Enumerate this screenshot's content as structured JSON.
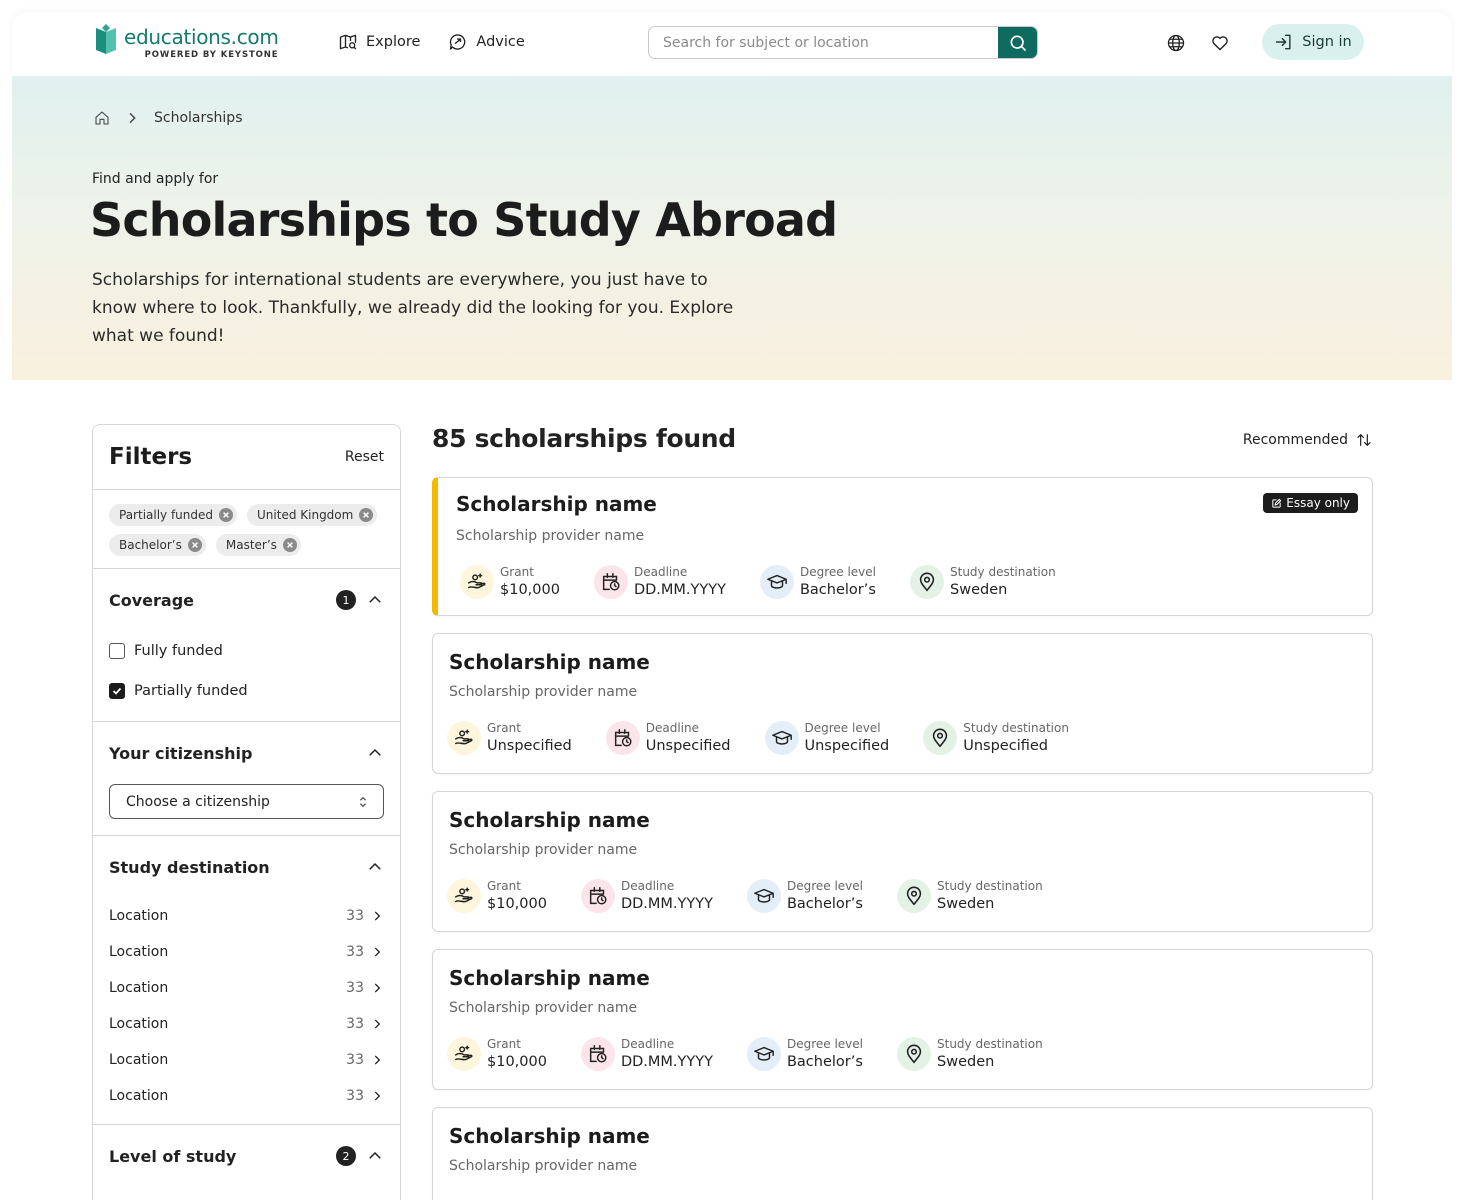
{
  "header": {
    "logo_name": "educations.com",
    "logo_sub": "POWERED BY KEYSTONE",
    "nav": [
      {
        "label": "Explore",
        "icon": "map-search-icon"
      },
      {
        "label": "Advice",
        "icon": "chat-icon"
      }
    ],
    "search_placeholder": "Search for subject or location",
    "sign_in": "Sign in",
    "brand_color": "#0f6b5f"
  },
  "hero": {
    "breadcrumb": "Scholarships",
    "kicker": "Find and apply for",
    "title": "Scholarships to Study Abroad",
    "description": "Scholarships for international students are everywhere, you just have to know where to look. Thankfully, we already did the looking for you. Explore what we found!"
  },
  "filters": {
    "title": "Filters",
    "reset": "Reset",
    "chips": [
      "Partially funded",
      "United Kingdom",
      "Bachelor’s",
      "Master’s"
    ],
    "coverage": {
      "title": "Coverage",
      "count": "1",
      "options": [
        {
          "label": "Fully funded",
          "checked": false
        },
        {
          "label": "Partially funded",
          "checked": true
        }
      ]
    },
    "citizenship": {
      "title": "Your citizenship",
      "select": "Choose a citizenship"
    },
    "destination": {
      "title": "Study destination",
      "locations": [
        {
          "label": "Location",
          "count": "33"
        },
        {
          "label": "Location",
          "count": "33"
        },
        {
          "label": "Location",
          "count": "33"
        },
        {
          "label": "Location",
          "count": "33"
        },
        {
          "label": "Location",
          "count": "33"
        },
        {
          "label": "Location",
          "count": "33"
        }
      ]
    },
    "level": {
      "title": "Level of study",
      "count": "2"
    }
  },
  "results": {
    "count_label": "85 scholarships found",
    "sort_label": "Recommended",
    "labels": {
      "grant": "Grant",
      "deadline": "Deadline",
      "degree": "Degree level",
      "destination": "Study destination"
    },
    "cards": [
      {
        "name": "Scholarship name",
        "provider": "Scholarship provider name",
        "badge": "Essay only",
        "grant": "$10,000",
        "deadline": "DD.MM.YYYY",
        "degree": "Bachelor’s",
        "destination": "Sweden"
      },
      {
        "name": "Scholarship name",
        "provider": "Scholarship provider name",
        "grant": "Unspecified",
        "deadline": "Unspecified",
        "degree": "Unspecified",
        "destination": "Unspecified"
      },
      {
        "name": "Scholarship name",
        "provider": "Scholarship provider name",
        "grant": "$10,000",
        "deadline": "DD.MM.YYYY",
        "degree": "Bachelor’s",
        "destination": "Sweden"
      },
      {
        "name": "Scholarship name",
        "provider": "Scholarship provider name",
        "grant": "$10,000",
        "deadline": "DD.MM.YYYY",
        "degree": "Bachelor’s",
        "destination": "Sweden"
      },
      {
        "name": "Scholarship name",
        "provider": "Scholarship provider name"
      }
    ],
    "featured_color": "#f2b900"
  }
}
